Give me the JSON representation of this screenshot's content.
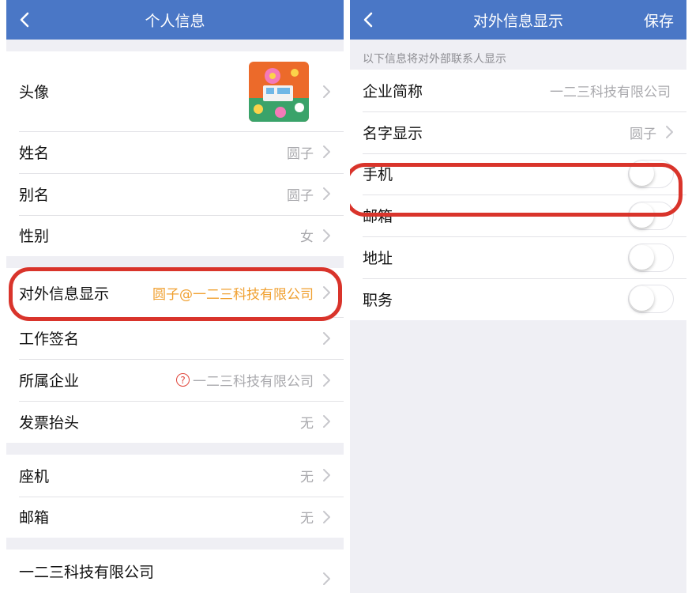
{
  "colors": {
    "nav_bg": "#4a77c6",
    "highlight": "#d9342b",
    "accent_orange": "#f0a030",
    "muted_text": "#a9a9ad"
  },
  "left": {
    "title": "个人信息",
    "rows": [
      {
        "label": "头像"
      },
      {
        "label": "姓名",
        "value": "圆子"
      },
      {
        "label": "别名",
        "value": "圆子"
      },
      {
        "label": "性别",
        "value": "女"
      },
      {
        "label": "对外信息显示",
        "value": "圆子@一二三科技有限公司"
      },
      {
        "label": "工作签名"
      },
      {
        "label": "所属企业",
        "value": "一二三科技有限公司",
        "icon": "question-circle-icon"
      },
      {
        "label": "发票抬头",
        "value": "无"
      },
      {
        "label": "座机",
        "value": "无"
      },
      {
        "label": "邮箱",
        "value": "无"
      },
      {
        "label": "一二三科技有限公司"
      }
    ]
  },
  "right": {
    "title": "对外信息显示",
    "save_label": "保存",
    "section_hint": "以下信息将对外部联系人显示",
    "rows": [
      {
        "label": "企业简称",
        "value": "一二三科技有限公司"
      },
      {
        "label": "名字显示",
        "value": "圆子"
      }
    ],
    "toggles": [
      {
        "label": "手机",
        "on": false
      },
      {
        "label": "邮箱",
        "on": false
      },
      {
        "label": "地址",
        "on": false
      },
      {
        "label": "职务",
        "on": false
      }
    ]
  }
}
